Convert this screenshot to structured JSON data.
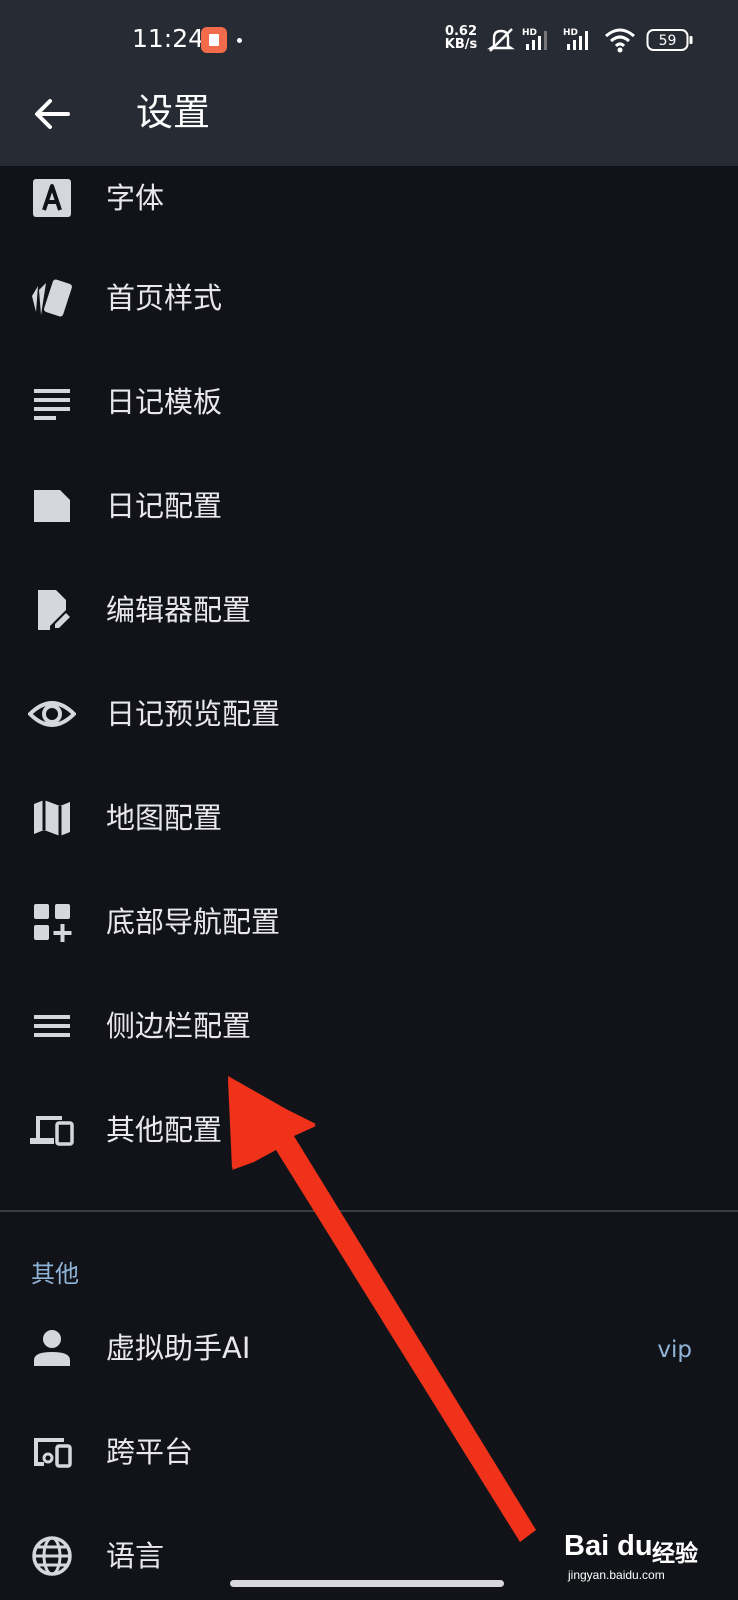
{
  "status_bar": {
    "time": "11:24",
    "net_speed_value": "0.62",
    "net_speed_unit": "KB/s",
    "signal1_label": "HD",
    "signal2_label": "HD",
    "battery": "59"
  },
  "appbar": {
    "title": "设置"
  },
  "settings_items": [
    {
      "label": "字体",
      "icon": "font-icon"
    },
    {
      "label": "首页样式",
      "icon": "style-icon"
    },
    {
      "label": "日记模板",
      "icon": "template-icon"
    },
    {
      "label": "日记配置",
      "icon": "note-icon"
    },
    {
      "label": "编辑器配置",
      "icon": "edit-note-icon"
    },
    {
      "label": "日记预览配置",
      "icon": "eye-icon"
    },
    {
      "label": "地图配置",
      "icon": "map-icon"
    },
    {
      "label": "底部导航配置",
      "icon": "add-widget-icon"
    },
    {
      "label": "侧边栏配置",
      "icon": "menu-icon"
    },
    {
      "label": "其他配置",
      "icon": "devices-icon"
    }
  ],
  "other_section": {
    "header": "其他",
    "items": [
      {
        "label": "虚拟助手AI",
        "extra": "vip",
        "icon": "person-icon"
      },
      {
        "label": "跨平台",
        "icon": "devices-other-icon"
      },
      {
        "label": "语言",
        "icon": "globe-icon"
      }
    ]
  },
  "watermark": {
    "brand": "Bai du",
    "text": "经验",
    "url": "jingyan.baidu.com"
  },
  "colors": {
    "background": "#111318",
    "appbar": "#272b33",
    "accent": "#8fb4d8",
    "arrow": "#f0321a"
  }
}
